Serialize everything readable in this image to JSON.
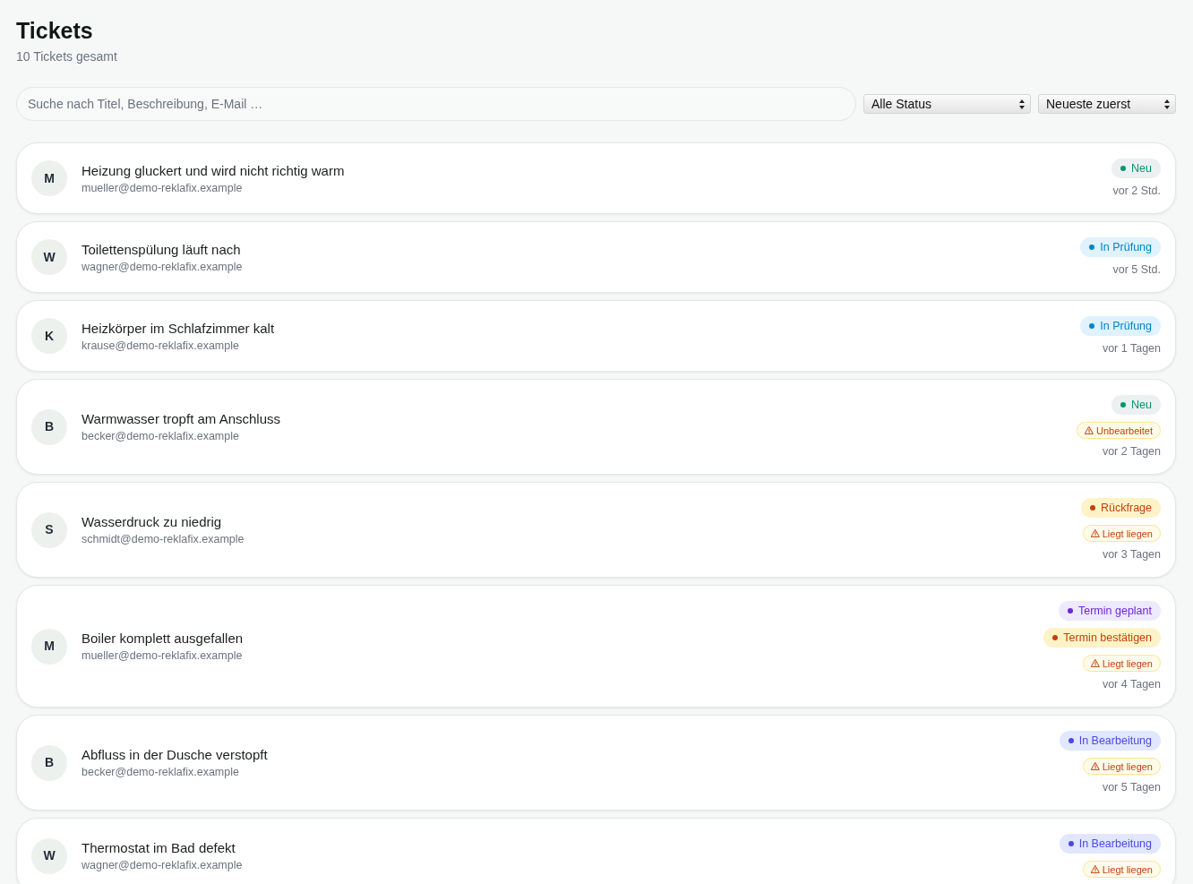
{
  "header": {
    "title": "Tickets",
    "subtitle": "10 Tickets gesamt"
  },
  "filters": {
    "search": {
      "placeholder": "Suche nach Titel, Beschreibung, E-Mail …"
    },
    "selects": [
      {
        "value": "Alle Status"
      },
      {
        "value": "Neueste zuerst"
      }
    ]
  },
  "tickets": [
    {
      "initial": "M",
      "title": "Heizung gluckert und wird nicht richtig warm",
      "email": "mueller@demo-reklafix.example",
      "badges": [
        {
          "kind": "status",
          "label": "Neu",
          "color": "#059669"
        }
      ],
      "time": "vor 2 Std."
    },
    {
      "initial": "W",
      "title": "Toilettenspülung läuft nach",
      "email": "wagner@demo-reklafix.example",
      "badges": [
        {
          "kind": "status",
          "label": "In Prüfung",
          "color": "#0284c7"
        }
      ],
      "time": "vor 5 Std."
    },
    {
      "initial": "K",
      "title": "Heizkörper im Schlafzimmer kalt",
      "email": "krause@demo-reklafix.example",
      "badges": [
        {
          "kind": "status",
          "label": "In Prüfung",
          "color": "#0284c7"
        }
      ],
      "time": "vor 1 Tagen"
    },
    {
      "initial": "B",
      "title": "Warmwasser tropft am Anschluss",
      "email": "becker@demo-reklafix.example",
      "badges": [
        {
          "kind": "status",
          "label": "Neu",
          "color": "#059669"
        },
        {
          "kind": "warning",
          "label": "Unbearbeitet"
        }
      ],
      "time": "vor 2 Tagen"
    },
    {
      "initial": "S",
      "title": "Wasserdruck zu niedrig",
      "email": "schmidt@demo-reklafix.example",
      "badges": [
        {
          "kind": "status",
          "label": "Rückfrage",
          "color": "#c2410c"
        },
        {
          "kind": "warning",
          "label": "Liegt liegen"
        }
      ],
      "time": "vor 3 Tagen"
    },
    {
      "initial": "M",
      "title": "Boiler komplett ausgefallen",
      "email": "mueller@demo-reklafix.example",
      "badges": [
        {
          "kind": "status",
          "label": "Termin geplant",
          "color": "#6d28d9"
        },
        {
          "kind": "status",
          "label": "Termin bestätigen",
          "color": "#c2410c"
        },
        {
          "kind": "warning",
          "label": "Liegt liegen"
        }
      ],
      "time": "vor 4 Tagen"
    },
    {
      "initial": "B",
      "title": "Abfluss in der Dusche verstopft",
      "email": "becker@demo-reklafix.example",
      "badges": [
        {
          "kind": "status",
          "label": "In Bearbeitung",
          "color": "#4f46e5"
        },
        {
          "kind": "warning",
          "label": "Liegt liegen"
        }
      ],
      "time": "vor 5 Tagen"
    },
    {
      "initial": "W",
      "title": "Thermostat im Bad defekt",
      "email": "wagner@demo-reklafix.example",
      "badges": [
        {
          "kind": "status",
          "label": "In Bearbeitung",
          "color": "#4f46e5"
        },
        {
          "kind": "warning",
          "label": "Liegt liegen"
        }
      ]
    }
  ]
}
